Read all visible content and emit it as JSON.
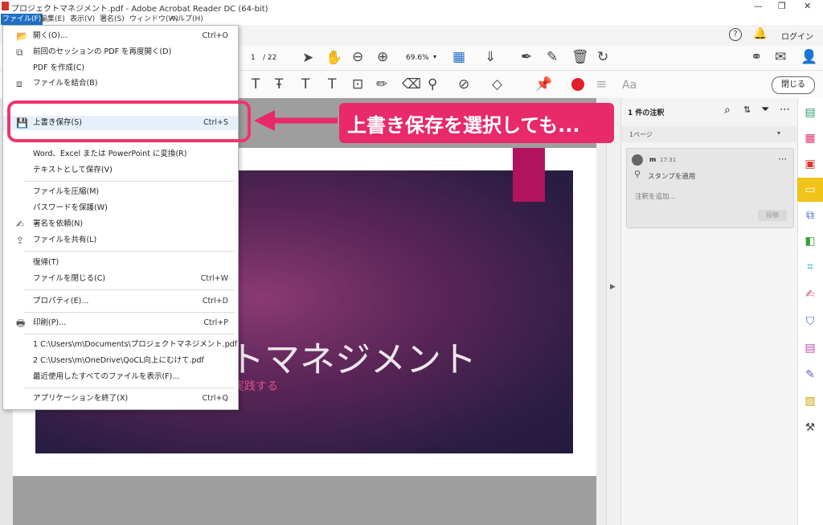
{
  "window": {
    "title": "プロジェクトマネジメント.pdf - Adobe Acrobat Reader DC (64-bit)"
  },
  "menubar": {
    "items": [
      "ファイル(F)",
      "編集(E)",
      "表示(V)",
      "署名(S)",
      "ウィンドウ(W)",
      "ヘルプ(H)"
    ]
  },
  "topstrip": {
    "login": "ログイン"
  },
  "toolbar": {
    "page_current": "1",
    "page_total": "/ 22",
    "zoom": "69.6%",
    "close_label": "閉じる",
    "font_glyph": "Aa"
  },
  "file_menu": {
    "items": [
      {
        "label": "開く(O)...",
        "shortcut": "Ctrl+O",
        "icon": "folder-open-icon"
      },
      {
        "label": "前回のセッションの PDF を再度開く(D)",
        "shortcut": "",
        "icon": "reopen-icon"
      },
      {
        "label": "PDF を作成(C)",
        "shortcut": "",
        "icon": ""
      },
      {
        "label": "ファイルを結合(B)",
        "shortcut": "",
        "icon": "combine-icon"
      },
      {
        "label": "上書き保存(S)",
        "shortcut": "Ctrl+S",
        "icon": "save-icon"
      },
      {
        "label": "Word、Excel または PowerPoint に変換(R)",
        "shortcut": "",
        "icon": ""
      },
      {
        "label": "テキストとして保存(V)",
        "shortcut": "",
        "icon": ""
      },
      {
        "label": "ファイルを圧縮(M)",
        "shortcut": "",
        "icon": ""
      },
      {
        "label": "パスワードを保護(W)",
        "shortcut": "",
        "icon": ""
      },
      {
        "label": "署名を依頼(N)",
        "shortcut": "",
        "icon": "sign-request-icon"
      },
      {
        "label": "ファイルを共有(L)",
        "shortcut": "",
        "icon": "share-icon"
      },
      {
        "label": "復帰(T)",
        "shortcut": "",
        "icon": ""
      },
      {
        "label": "ファイルを閉じる(C)",
        "shortcut": "Ctrl+W",
        "icon": ""
      },
      {
        "label": "プロパティ(E)...",
        "shortcut": "Ctrl+D",
        "icon": ""
      },
      {
        "label": "印刷(P)...",
        "shortcut": "Ctrl+P",
        "icon": "print-icon"
      },
      {
        "label": "1 C:\\Users\\m\\Documents\\プロジェクトマネジメント.pdf",
        "shortcut": "",
        "icon": ""
      },
      {
        "label": "2 C:\\Users\\m\\OneDrive\\QoCL向上にむけて.pdf",
        "shortcut": "",
        "icon": ""
      },
      {
        "label": "最近使用したすべてのファイルを表示(F)...",
        "shortcut": "",
        "icon": ""
      },
      {
        "label": "アプリケーションを終了(X)",
        "shortcut": "Ctrl+Q",
        "icon": ""
      }
    ]
  },
  "annotation": {
    "callout": "上書き保存を選択しても..."
  },
  "slide": {
    "title": "トマネジメント",
    "subtitle": "実践する"
  },
  "comments": {
    "header": "1 件の注釈",
    "section": "1ページ",
    "author": "m",
    "time": "17:31",
    "stamp": "スタンプを適用",
    "reply_placeholder": "注釈を追加...",
    "post_label": "投稿"
  },
  "colors": {
    "accent": "#1f6fc5",
    "annotation": "#e8296a",
    "ribbon": "#b1135f"
  }
}
